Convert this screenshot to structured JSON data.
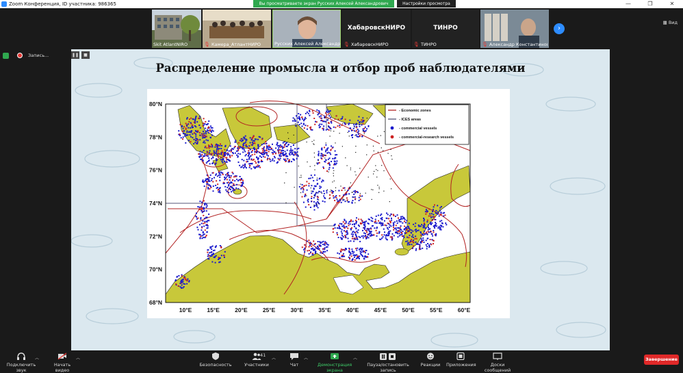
{
  "window": {
    "title": "Zoom Конференция, ID участника: 986365",
    "min": "—",
    "max": "❐",
    "close": "✕"
  },
  "banner": {
    "message": "Вы просматриваете экран Русских Алексей Александрович ...",
    "options": "Настройки просмотра ⌄"
  },
  "participants": [
    {
      "name": "Skit AtlantNIRO",
      "muted": false,
      "big": ""
    },
    {
      "name": "Камера_АтлантНИРО",
      "muted": true,
      "big": ""
    },
    {
      "name": "Русских Алексей Александро...",
      "muted": false,
      "big": ""
    },
    {
      "name": "ХабаровскНИРО",
      "muted": true,
      "big": "ХабаровскНИРО"
    },
    {
      "name": "ТИНРО",
      "muted": true,
      "big": "ТИНРО"
    },
    {
      "name": "Александр Константинови...",
      "muted": true,
      "big": ""
    }
  ],
  "strip": {
    "next": "›",
    "view": "▦ Вид"
  },
  "recording": {
    "label": "Запись...",
    "pause": "❚❚",
    "stop": "■"
  },
  "slide": {
    "title": "Распределение промысла и отбор проб наблюдателями"
  },
  "map": {
    "lat_labels": [
      "80°N",
      "78°N",
      "76°N",
      "74°N",
      "72°N",
      "70°N",
      "68°N"
    ],
    "lon_labels": [
      "10°E",
      "15°E",
      "20°E",
      "25°E",
      "30°E",
      "35°E",
      "40°E",
      "45°E",
      "50°E",
      "55°E",
      "60°E"
    ],
    "legend": [
      {
        "label": "- Economic zones",
        "kind": "line",
        "color": "#b22222"
      },
      {
        "label": "- ICES areas",
        "kind": "line",
        "color": "#555577"
      },
      {
        "label": "- commercial vessels",
        "kind": "dot",
        "color": "#1a1acc"
      },
      {
        "label": "- commercial-research vessels",
        "kind": "dot",
        "color": "#cc2222"
      }
    ],
    "colors": {
      "land": "#c8c83a",
      "sea": "#ffffff",
      "commercial": "#1a1acc",
      "research": "#cc2222",
      "zone": "#b22222",
      "ices": "#555577"
    }
  },
  "toolbar": {
    "items": [
      {
        "label": "Подключить звук",
        "icon": "headphones-icon"
      },
      {
        "label": "Начать видео",
        "icon": "video-off-icon"
      },
      {
        "label": "Безопасность",
        "icon": "shield-icon"
      },
      {
        "label": "Участники",
        "icon": "participants-icon"
      },
      {
        "label": "Чат",
        "icon": "chat-icon"
      },
      {
        "label": "Демонстрация экрана",
        "icon": "share-screen-icon"
      },
      {
        "label": "Пауза/остановить запись",
        "icon": "pause-record-icon"
      },
      {
        "label": "Реакции",
        "icon": "reactions-icon"
      },
      {
        "label": "Приложения",
        "icon": "apps-icon"
      },
      {
        "label": "Доски сообщений",
        "icon": "whiteboard-icon"
      }
    ],
    "participants_count": "41",
    "end": "Завершение"
  }
}
